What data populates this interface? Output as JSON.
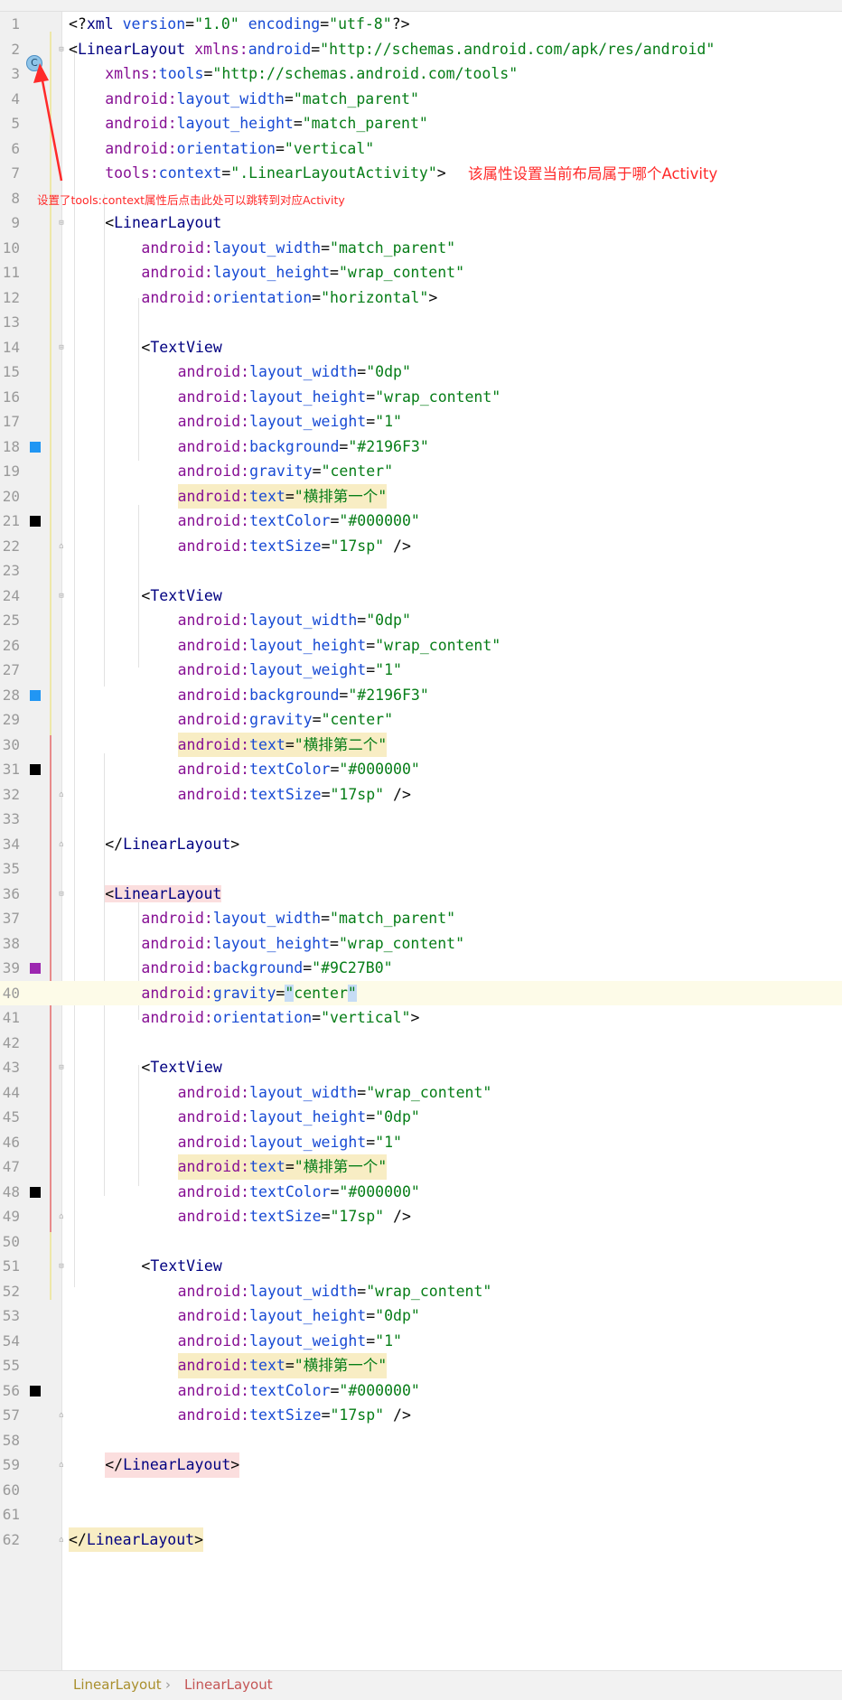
{
  "lines": [
    {
      "n": "1",
      "indent": 0,
      "tokens": [
        [
          "p",
          "<?"
        ],
        [
          "tag",
          "xml "
        ],
        [
          "attr",
          "version"
        ],
        [
          "p",
          "="
        ],
        [
          "val",
          "\"1.0\" "
        ],
        [
          "attr",
          "encoding"
        ],
        [
          "p",
          "="
        ],
        [
          "val",
          "\"utf-8\""
        ],
        [
          "p",
          "?>"
        ]
      ]
    },
    {
      "n": "2",
      "indent": 0,
      "tokens": [
        [
          "p",
          "<"
        ],
        [
          "tag",
          "LinearLayout "
        ],
        [
          "ns",
          "xmlns:"
        ],
        [
          "attr",
          "android"
        ],
        [
          "p",
          "="
        ],
        [
          "val",
          "\"http://schemas.android.com/apk/res/android\""
        ]
      ]
    },
    {
      "n": "3",
      "indent": 1,
      "tokens": [
        [
          "ns",
          "xmlns:"
        ],
        [
          "attr",
          "tools"
        ],
        [
          "p",
          "="
        ],
        [
          "val",
          "\"http://schemas.android.com/tools\""
        ]
      ]
    },
    {
      "n": "4",
      "indent": 1,
      "tokens": [
        [
          "ns",
          "android:"
        ],
        [
          "attr",
          "layout_width"
        ],
        [
          "p",
          "="
        ],
        [
          "val",
          "\"match_parent\""
        ]
      ]
    },
    {
      "n": "5",
      "indent": 1,
      "tokens": [
        [
          "ns",
          "android:"
        ],
        [
          "attr",
          "layout_height"
        ],
        [
          "p",
          "="
        ],
        [
          "val",
          "\"match_parent\""
        ]
      ]
    },
    {
      "n": "6",
      "indent": 1,
      "tokens": [
        [
          "ns",
          "android:"
        ],
        [
          "attr",
          "orientation"
        ],
        [
          "p",
          "="
        ],
        [
          "val",
          "\"vertical\""
        ]
      ]
    },
    {
      "n": "7",
      "indent": 1,
      "tokens": [
        [
          "ns",
          "tools:"
        ],
        [
          "attr",
          "context"
        ],
        [
          "p",
          "="
        ],
        [
          "val",
          "\".LinearLayoutActivity\""
        ],
        [
          "p",
          ">"
        ]
      ]
    },
    {
      "n": "8",
      "indent": 0,
      "tokens": []
    },
    {
      "n": "9",
      "indent": 1,
      "tokens": [
        [
          "p",
          "<"
        ],
        [
          "tag",
          "LinearLayout"
        ]
      ]
    },
    {
      "n": "10",
      "indent": 2,
      "tokens": [
        [
          "ns",
          "android:"
        ],
        [
          "attr",
          "layout_width"
        ],
        [
          "p",
          "="
        ],
        [
          "val",
          "\"match_parent\""
        ]
      ]
    },
    {
      "n": "11",
      "indent": 2,
      "tokens": [
        [
          "ns",
          "android:"
        ],
        [
          "attr",
          "layout_height"
        ],
        [
          "p",
          "="
        ],
        [
          "val",
          "\"wrap_content\""
        ]
      ]
    },
    {
      "n": "12",
      "indent": 2,
      "tokens": [
        [
          "ns",
          "android:"
        ],
        [
          "attr",
          "orientation"
        ],
        [
          "p",
          "="
        ],
        [
          "val",
          "\"horizontal\""
        ],
        [
          "p",
          ">"
        ]
      ]
    },
    {
      "n": "13",
      "indent": 0,
      "tokens": []
    },
    {
      "n": "14",
      "indent": 2,
      "tokens": [
        [
          "p",
          "<"
        ],
        [
          "tag",
          "TextView"
        ]
      ]
    },
    {
      "n": "15",
      "indent": 3,
      "tokens": [
        [
          "ns",
          "android:"
        ],
        [
          "attr",
          "layout_width"
        ],
        [
          "p",
          "="
        ],
        [
          "val",
          "\"0dp\""
        ]
      ]
    },
    {
      "n": "16",
      "indent": 3,
      "tokens": [
        [
          "ns",
          "android:"
        ],
        [
          "attr",
          "layout_height"
        ],
        [
          "p",
          "="
        ],
        [
          "val",
          "\"wrap_content\""
        ]
      ]
    },
    {
      "n": "17",
      "indent": 3,
      "tokens": [
        [
          "ns",
          "android:"
        ],
        [
          "attr",
          "layout_weight"
        ],
        [
          "p",
          "="
        ],
        [
          "val",
          "\"1\""
        ]
      ]
    },
    {
      "n": "18",
      "indent": 3,
      "tokens": [
        [
          "ns",
          "android:"
        ],
        [
          "attr",
          "background"
        ],
        [
          "p",
          "="
        ],
        [
          "val",
          "\"#2196F3\""
        ]
      ]
    },
    {
      "n": "19",
      "indent": 3,
      "tokens": [
        [
          "ns",
          "android:"
        ],
        [
          "attr",
          "gravity"
        ],
        [
          "p",
          "="
        ],
        [
          "val",
          "\"center\""
        ]
      ]
    },
    {
      "n": "20",
      "indent": 3,
      "highlight": true,
      "tokens": [
        [
          "ns",
          "android:"
        ],
        [
          "attr",
          "text"
        ],
        [
          "p",
          "="
        ],
        [
          "val",
          "\"横排第一个\""
        ]
      ]
    },
    {
      "n": "21",
      "indent": 3,
      "tokens": [
        [
          "ns",
          "android:"
        ],
        [
          "attr",
          "textColor"
        ],
        [
          "p",
          "="
        ],
        [
          "val",
          "\"#000000\""
        ]
      ]
    },
    {
      "n": "22",
      "indent": 3,
      "tokens": [
        [
          "ns",
          "android:"
        ],
        [
          "attr",
          "textSize"
        ],
        [
          "p",
          "="
        ],
        [
          "val",
          "\"17sp\" "
        ],
        [
          "p",
          "/>"
        ]
      ]
    },
    {
      "n": "23",
      "indent": 0,
      "tokens": []
    },
    {
      "n": "24",
      "indent": 2,
      "tokens": [
        [
          "p",
          "<"
        ],
        [
          "tag",
          "TextView"
        ]
      ]
    },
    {
      "n": "25",
      "indent": 3,
      "tokens": [
        [
          "ns",
          "android:"
        ],
        [
          "attr",
          "layout_width"
        ],
        [
          "p",
          "="
        ],
        [
          "val",
          "\"0dp\""
        ]
      ]
    },
    {
      "n": "26",
      "indent": 3,
      "tokens": [
        [
          "ns",
          "android:"
        ],
        [
          "attr",
          "layout_height"
        ],
        [
          "p",
          "="
        ],
        [
          "val",
          "\"wrap_content\""
        ]
      ]
    },
    {
      "n": "27",
      "indent": 3,
      "tokens": [
        [
          "ns",
          "android:"
        ],
        [
          "attr",
          "layout_weight"
        ],
        [
          "p",
          "="
        ],
        [
          "val",
          "\"1\""
        ]
      ]
    },
    {
      "n": "28",
      "indent": 3,
      "tokens": [
        [
          "ns",
          "android:"
        ],
        [
          "attr",
          "background"
        ],
        [
          "p",
          "="
        ],
        [
          "val",
          "\"#2196F3\""
        ]
      ]
    },
    {
      "n": "29",
      "indent": 3,
      "tokens": [
        [
          "ns",
          "android:"
        ],
        [
          "attr",
          "gravity"
        ],
        [
          "p",
          "="
        ],
        [
          "val",
          "\"center\""
        ]
      ]
    },
    {
      "n": "30",
      "indent": 3,
      "highlight": true,
      "tokens": [
        [
          "ns",
          "android:"
        ],
        [
          "attr",
          "text"
        ],
        [
          "p",
          "="
        ],
        [
          "val",
          "\"横排第二个\""
        ]
      ]
    },
    {
      "n": "31",
      "indent": 3,
      "tokens": [
        [
          "ns",
          "android:"
        ],
        [
          "attr",
          "textColor"
        ],
        [
          "p",
          "="
        ],
        [
          "val",
          "\"#000000\""
        ]
      ]
    },
    {
      "n": "32",
      "indent": 3,
      "tokens": [
        [
          "ns",
          "android:"
        ],
        [
          "attr",
          "textSize"
        ],
        [
          "p",
          "="
        ],
        [
          "val",
          "\"17sp\" "
        ],
        [
          "p",
          "/>"
        ]
      ]
    },
    {
      "n": "33",
      "indent": 0,
      "tokens": []
    },
    {
      "n": "34",
      "indent": 1,
      "tokens": [
        [
          "p",
          "</"
        ],
        [
          "tag",
          "LinearLayout"
        ],
        [
          "p",
          ">"
        ]
      ]
    },
    {
      "n": "35",
      "indent": 0,
      "tokens": []
    },
    {
      "n": "36",
      "indent": 1,
      "pinkTag": true,
      "tokens": [
        [
          "p",
          "<"
        ],
        [
          "tag",
          "LinearLayout"
        ]
      ]
    },
    {
      "n": "37",
      "indent": 2,
      "tokens": [
        [
          "ns",
          "android:"
        ],
        [
          "attr",
          "layout_width"
        ],
        [
          "p",
          "="
        ],
        [
          "val",
          "\"match_parent\""
        ]
      ]
    },
    {
      "n": "38",
      "indent": 2,
      "tokens": [
        [
          "ns",
          "android:"
        ],
        [
          "attr",
          "layout_height"
        ],
        [
          "p",
          "="
        ],
        [
          "val",
          "\"wrap_content\""
        ]
      ]
    },
    {
      "n": "39",
      "indent": 2,
      "tokens": [
        [
          "ns",
          "android:"
        ],
        [
          "attr",
          "background"
        ],
        [
          "p",
          "="
        ],
        [
          "val",
          "\"#9C27B0\""
        ]
      ]
    },
    {
      "n": "40",
      "indent": 2,
      "current": true,
      "tokens": [
        [
          "ns",
          "android:"
        ],
        [
          "attr",
          "gravity"
        ],
        [
          "p",
          "="
        ],
        [
          "caret",
          "\""
        ],
        [
          "val",
          "center"
        ],
        [
          "caret",
          "\""
        ]
      ]
    },
    {
      "n": "41",
      "indent": 2,
      "tokens": [
        [
          "ns",
          "android:"
        ],
        [
          "attr",
          "orientation"
        ],
        [
          "p",
          "="
        ],
        [
          "val",
          "\"vertical\""
        ],
        [
          "p",
          ">"
        ]
      ]
    },
    {
      "n": "42",
      "indent": 0,
      "tokens": []
    },
    {
      "n": "43",
      "indent": 2,
      "tokens": [
        [
          "p",
          "<"
        ],
        [
          "tag",
          "TextView"
        ]
      ]
    },
    {
      "n": "44",
      "indent": 3,
      "tokens": [
        [
          "ns",
          "android:"
        ],
        [
          "attr",
          "layout_width"
        ],
        [
          "p",
          "="
        ],
        [
          "val",
          "\"wrap_content\""
        ]
      ]
    },
    {
      "n": "45",
      "indent": 3,
      "tokens": [
        [
          "ns",
          "android:"
        ],
        [
          "attr",
          "layout_height"
        ],
        [
          "p",
          "="
        ],
        [
          "val",
          "\"0dp\""
        ]
      ]
    },
    {
      "n": "46",
      "indent": 3,
      "tokens": [
        [
          "ns",
          "android:"
        ],
        [
          "attr",
          "layout_weight"
        ],
        [
          "p",
          "="
        ],
        [
          "val",
          "\"1\""
        ]
      ]
    },
    {
      "n": "47",
      "indent": 3,
      "highlight": true,
      "tokens": [
        [
          "ns",
          "android:"
        ],
        [
          "attr",
          "text"
        ],
        [
          "p",
          "="
        ],
        [
          "val",
          "\"横排第一个\""
        ]
      ]
    },
    {
      "n": "48",
      "indent": 3,
      "tokens": [
        [
          "ns",
          "android:"
        ],
        [
          "attr",
          "textColor"
        ],
        [
          "p",
          "="
        ],
        [
          "val",
          "\"#000000\""
        ]
      ]
    },
    {
      "n": "49",
      "indent": 3,
      "tokens": [
        [
          "ns",
          "android:"
        ],
        [
          "attr",
          "textSize"
        ],
        [
          "p",
          "="
        ],
        [
          "val",
          "\"17sp\" "
        ],
        [
          "p",
          "/>"
        ]
      ]
    },
    {
      "n": "50",
      "indent": 0,
      "tokens": []
    },
    {
      "n": "51",
      "indent": 2,
      "tokens": [
        [
          "p",
          "<"
        ],
        [
          "tag",
          "TextView"
        ]
      ]
    },
    {
      "n": "52",
      "indent": 3,
      "tokens": [
        [
          "ns",
          "android:"
        ],
        [
          "attr",
          "layout_width"
        ],
        [
          "p",
          "="
        ],
        [
          "val",
          "\"wrap_content\""
        ]
      ]
    },
    {
      "n": "53",
      "indent": 3,
      "tokens": [
        [
          "ns",
          "android:"
        ],
        [
          "attr",
          "layout_height"
        ],
        [
          "p",
          "="
        ],
        [
          "val",
          "\"0dp\""
        ]
      ]
    },
    {
      "n": "54",
      "indent": 3,
      "tokens": [
        [
          "ns",
          "android:"
        ],
        [
          "attr",
          "layout_weight"
        ],
        [
          "p",
          "="
        ],
        [
          "val",
          "\"1\""
        ]
      ]
    },
    {
      "n": "55",
      "indent": 3,
      "highlight": true,
      "tokens": [
        [
          "ns",
          "android:"
        ],
        [
          "attr",
          "text"
        ],
        [
          "p",
          "="
        ],
        [
          "val",
          "\"横排第一个\""
        ]
      ]
    },
    {
      "n": "56",
      "indent": 3,
      "tokens": [
        [
          "ns",
          "android:"
        ],
        [
          "attr",
          "textColor"
        ],
        [
          "p",
          "="
        ],
        [
          "val",
          "\"#000000\""
        ]
      ]
    },
    {
      "n": "57",
      "indent": 3,
      "tokens": [
        [
          "ns",
          "android:"
        ],
        [
          "attr",
          "textSize"
        ],
        [
          "p",
          "="
        ],
        [
          "val",
          "\"17sp\" "
        ],
        [
          "p",
          "/>"
        ]
      ]
    },
    {
      "n": "58",
      "indent": 0,
      "tokens": []
    },
    {
      "n": "59",
      "indent": 1,
      "pinkAll": true,
      "tokens": [
        [
          "p",
          "</"
        ],
        [
          "tag",
          "LinearLayout"
        ],
        [
          "p",
          ">"
        ]
      ]
    },
    {
      "n": "60",
      "indent": 0,
      "tokens": []
    },
    {
      "n": "61",
      "indent": 0,
      "tokens": []
    },
    {
      "n": "62",
      "indent": 0,
      "highlight": true,
      "tokens": [
        [
          "p",
          "</"
        ],
        [
          "tag",
          "LinearLayout"
        ],
        [
          "p",
          ">"
        ]
      ]
    }
  ],
  "gutter_swatches": [
    {
      "line": "18",
      "color": "#2196F3"
    },
    {
      "line": "21",
      "color": "#000000"
    },
    {
      "line": "28",
      "color": "#2196F3"
    },
    {
      "line": "31",
      "color": "#000000"
    },
    {
      "line": "39",
      "color": "#9C27B0"
    },
    {
      "line": "48",
      "color": "#000000"
    },
    {
      "line": "56",
      "color": "#000000"
    }
  ],
  "gutter_icon": {
    "line": "2",
    "glyph": "C",
    "name": "activity-class-icon"
  },
  "annotations": {
    "context_note": "该属性设置当前布局属于哪个Activity",
    "jump_note": "设置了tools:context属性后点击此处可以跳转到对应Activity",
    "color": "#ff2a2a"
  },
  "breadcrumb": {
    "items": [
      "LinearLayout",
      "LinearLayout"
    ],
    "separator": "›"
  },
  "colors": {
    "tag": "#000080",
    "namespace": "#871094",
    "attribute": "#174ad4",
    "value": "#067d17",
    "text_highlight": "#f8edc4",
    "current_line": "#fdfbe8"
  }
}
